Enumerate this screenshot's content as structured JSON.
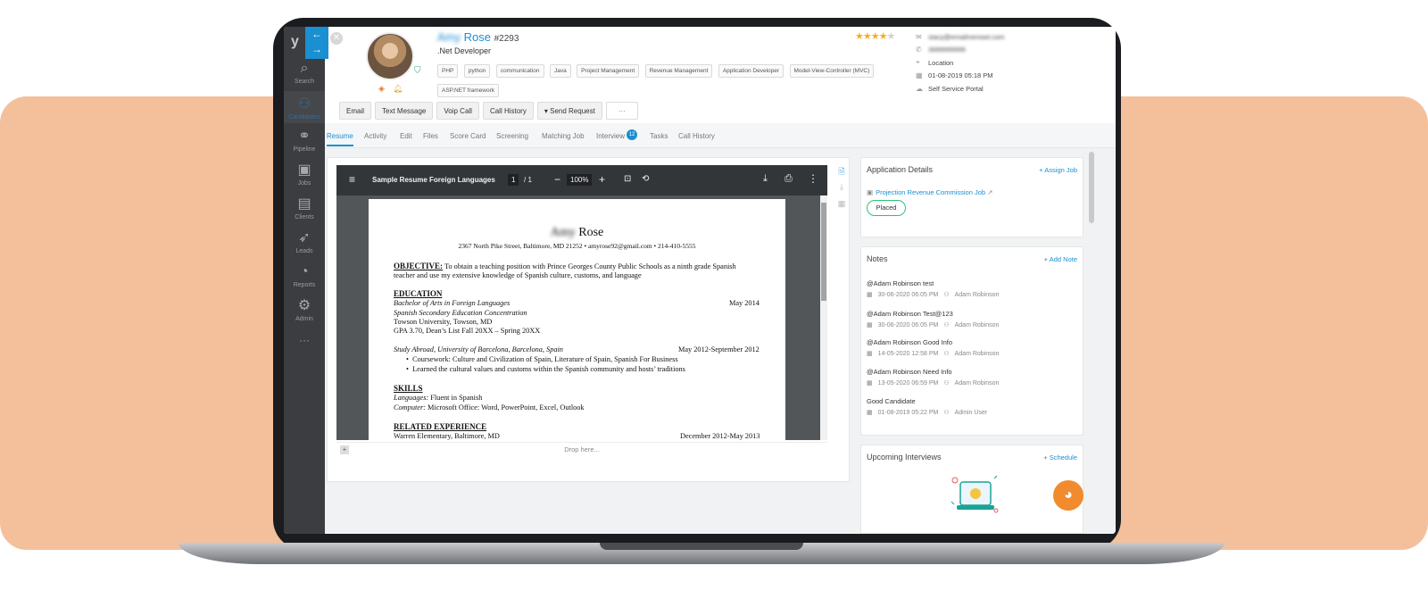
{
  "sidebar": {
    "logo": "y",
    "arrows": [
      "←",
      "→"
    ],
    "items": [
      {
        "label": "Search",
        "icon": "search-icon"
      },
      {
        "label": "Candidates",
        "icon": "users-icon"
      },
      {
        "label": "Pipeline",
        "icon": "pipeline-icon"
      },
      {
        "label": "Jobs",
        "icon": "briefcase-icon"
      },
      {
        "label": "Clients",
        "icon": "clients-icon"
      },
      {
        "label": "Leads",
        "icon": "rocket-icon"
      },
      {
        "label": "Reports",
        "icon": "pie-chart-icon"
      },
      {
        "label": "Admin",
        "icon": "gear-icon"
      }
    ],
    "more": "···"
  },
  "candidate": {
    "first_name": "Amy",
    "last_name": "Rose",
    "id": "#2293",
    "role": ".Net Developer",
    "skills": [
      "PHP",
      "python",
      "communication",
      "Java",
      "Project Management",
      "Revenue Management",
      "Application Developer",
      "Model-View-Controller (MVC)",
      "ASP.NET framework"
    ],
    "rating": 4,
    "rating_max": 5,
    "email": "stacy@emailmenowt.com",
    "phone": "3999999999",
    "location": "Location",
    "date": "01-08-2019 05:18 PM",
    "source": "Self Service Portal"
  },
  "actions": [
    "Email",
    "Text Message",
    "Voip Call",
    "Call History",
    "Send Request",
    "···"
  ],
  "tabs": [
    {
      "label": "Resume",
      "active": true
    },
    {
      "label": "Activity"
    },
    {
      "label": "Edit"
    },
    {
      "label": "Files"
    },
    {
      "label": "Score Card"
    },
    {
      "label": "Screening"
    },
    {
      "label": "Matching Job"
    },
    {
      "label": "Interview",
      "badge": "12"
    },
    {
      "label": "Tasks"
    },
    {
      "label": "Call History"
    }
  ],
  "pdf": {
    "title": "Sample Resume Foreign Languages",
    "page": "1",
    "pages": "/ 1",
    "zoom": "100%",
    "drop_text": "Drop here..."
  },
  "resume": {
    "name_first": "Amy",
    "name_last": "Rose",
    "address": "2367 North Pike Street, Baltimore, MD 21252 • amyrose92@gmail.com • 214-410-5555",
    "objective_head": "OBJECTIVE:",
    "objective_1": "To obtain a teaching position with Prince Georges County Public Schools as a ninth grade Spanish",
    "objective_2": "teacher and use my extensive knowledge of Spanish culture, customs, and language",
    "education_head": "EDUCATION",
    "edu_1": "Bachelor of Arts in Foreign Languages",
    "edu_1_date": "May 2014",
    "edu_2": "Spanish Secondary Education Concentration",
    "edu_3": "Towson University, Towson, MD",
    "edu_4": "GPA 3.70, Dean’s List Fall 20XX – Spring 20XX",
    "study_abroad": "Study Abroad, University of Barcelona, Barcelona, Spain",
    "study_date": "May 2012-September 2012",
    "bullet_1": "Coursework: Culture and Civilization of Spain, Literature of Spain, Spanish For Business",
    "bullet_2": "Learned the cultural values and customs within the Spanish community and hosts’ traditions",
    "skills_head": "SKILLS",
    "lang_label": "Languages:",
    "lang_value": "Fluent in Spanish",
    "comp_label": "Computer:",
    "comp_value": "Microsoft Office: Word, PowerPoint, Excel, Outlook",
    "exp_head": "RELATED EXPERIENCE",
    "exp_1": "Warren Elementary, Baltimore, MD",
    "exp_1_date": "December 2012-May 2013"
  },
  "application": {
    "title": "Application Details",
    "assign": "+ Assign Job",
    "job": "Projection Revenue Commission Job",
    "status": "Placed"
  },
  "notes": {
    "title": "Notes",
    "add": "+ Add Note",
    "items": [
      {
        "text": "@Adam Robinson test",
        "date": "30-06-2020 06:05 PM",
        "user": "Adam Robinson"
      },
      {
        "text": "@Adam Robinson Test@123",
        "date": "30-06-2020 06:05 PM",
        "user": "Adam Robinson"
      },
      {
        "text": "@Adam Robinson Good Info",
        "date": "14-05-2020 12:58 PM",
        "user": "Adam Robinson"
      },
      {
        "text": "@Adam Robinson Need Info",
        "date": "13-05-2020 06:59 PM",
        "user": "Adam Robinson"
      },
      {
        "text": "Good Candidate",
        "date": "01-08-2019 05:22 PM",
        "user": "Admin User"
      }
    ]
  },
  "interviews": {
    "title": "Upcoming Interviews",
    "schedule": "+ Schedule"
  },
  "colors": {
    "accent": "#1a8fd1",
    "peach": "#f4c09c",
    "sidebar": "#3b3d40",
    "placed": "#2fbf7a",
    "chat": "#f18b2e"
  }
}
